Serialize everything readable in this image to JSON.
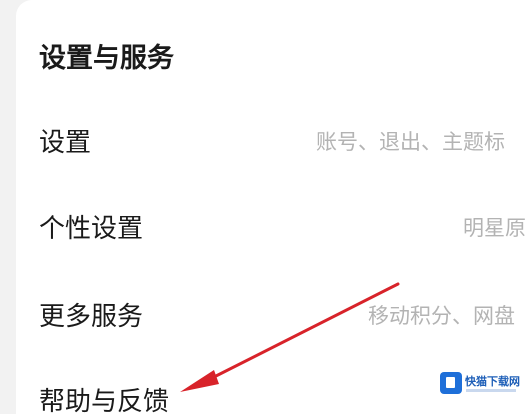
{
  "section": {
    "title": "设置与服务"
  },
  "rows": [
    {
      "label": "设置",
      "value": "账号、退出、主题标"
    },
    {
      "label": "个性设置",
      "value": "明星原"
    },
    {
      "label": "更多服务",
      "value": "移动积分、网盘"
    },
    {
      "label": "帮助与反馈",
      "value": ""
    }
  ],
  "watermark": {
    "text": "快猫下载网"
  },
  "colors": {
    "background": "#f2f2f2",
    "card": "#ffffff",
    "text": "#1a1a1a",
    "secondary_text": "#b3b3b3",
    "annotation_arrow": "#d8232a"
  }
}
